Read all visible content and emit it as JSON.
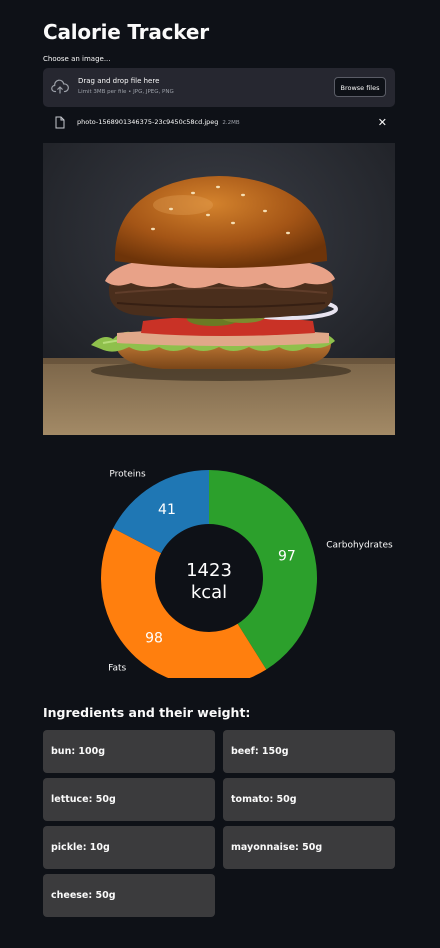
{
  "app": {
    "title": "Calorie Tracker"
  },
  "uploader": {
    "label": "Choose an image...",
    "drop_text": "Drag and drop file here",
    "limit_text": "Limit 3MB per file • JPG, JPEG, PNG",
    "browse_label": "Browse files",
    "file_name": "photo-1568901346375-23c9450c58cd.jpeg",
    "file_size": "2.2MB",
    "close_glyph": "✕"
  },
  "photo": {
    "subject": "burger-photo"
  },
  "chart_data": {
    "type": "pie",
    "donut": true,
    "center_value": "1423",
    "center_unit": "kcal",
    "series": [
      {
        "name": "Carbohydrates",
        "value": 97,
        "color": "#2ca02c"
      },
      {
        "name": "Fats",
        "value": 98,
        "color": "#ff7f0e"
      },
      {
        "name": "Proteins",
        "value": 41,
        "color": "#1f77b4"
      }
    ]
  },
  "ingredients": {
    "title": "Ingredients and their weight:",
    "items": [
      "bun: 100g",
      "beef: 150g",
      "lettuce: 50g",
      "tomato: 50g",
      "pickle: 10g",
      "mayonnaise: 50g",
      "cheese: 50g"
    ]
  }
}
